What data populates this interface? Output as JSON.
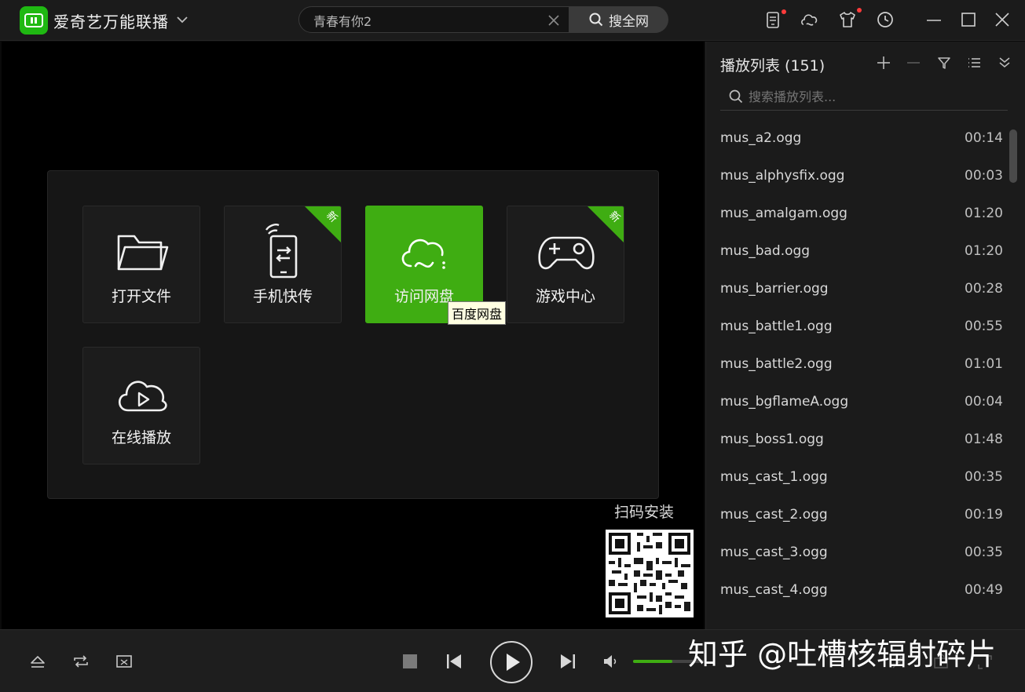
{
  "titlebar": {
    "app_title": "爱奇艺万能联播",
    "search_value": "青春有你2",
    "search_button": "搜全网"
  },
  "tiles": [
    {
      "label": "打开文件",
      "icon": "folder-icon",
      "badge": ""
    },
    {
      "label": "手机快传",
      "icon": "phone-transfer-icon",
      "badge": "新"
    },
    {
      "label": "访问网盘",
      "icon": "cloud-drive-icon",
      "badge": ""
    },
    {
      "label": "游戏中心",
      "icon": "gamepad-icon",
      "badge": "新"
    },
    {
      "label": "在线播放",
      "icon": "cloud-play-icon",
      "badge": ""
    }
  ],
  "tooltip": "百度网盘",
  "qr_label": "扫码安装",
  "playlist": {
    "title": "播放列表 (151)",
    "search_placeholder": "搜索播放列表...",
    "items": [
      {
        "name": "mus_a2.ogg",
        "duration": "00:14"
      },
      {
        "name": "mus_alphysfix.ogg",
        "duration": "00:03"
      },
      {
        "name": "mus_amalgam.ogg",
        "duration": "01:20"
      },
      {
        "name": "mus_bad.ogg",
        "duration": "01:20"
      },
      {
        "name": "mus_barrier.ogg",
        "duration": "00:28"
      },
      {
        "name": "mus_battle1.ogg",
        "duration": "00:55"
      },
      {
        "name": "mus_battle2.ogg",
        "duration": "01:01"
      },
      {
        "name": "mus_bgflameA.ogg",
        "duration": "00:04"
      },
      {
        "name": "mus_boss1.ogg",
        "duration": "01:48"
      },
      {
        "name": "mus_cast_1.ogg",
        "duration": "00:35"
      },
      {
        "name": "mus_cast_2.ogg",
        "duration": "00:19"
      },
      {
        "name": "mus_cast_3.ogg",
        "duration": "00:35"
      },
      {
        "name": "mus_cast_4.ogg",
        "duration": "00:49"
      }
    ]
  },
  "player": {
    "volume": 0.55
  },
  "watermark": "知乎 @吐槽核辐射碎片",
  "colors": {
    "accent": "#3fad12",
    "logo": "#1fb812",
    "background": "#000000",
    "panel": "#1b1b1b"
  }
}
